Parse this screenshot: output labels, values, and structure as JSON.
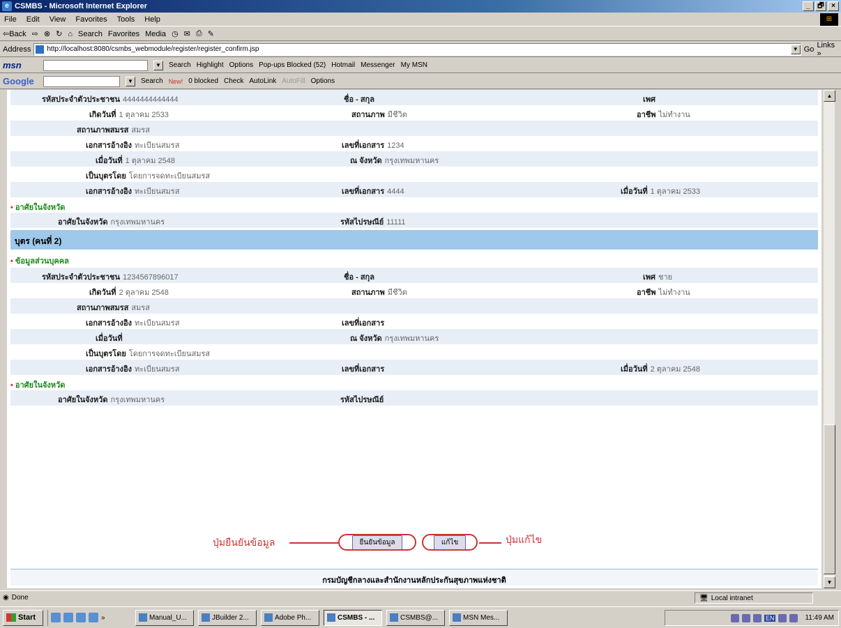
{
  "window": {
    "title": "CSMBS - Microsoft Internet Explorer",
    "min": "_",
    "max": "🗗",
    "close": "×"
  },
  "menu": [
    "File",
    "Edit",
    "View",
    "Favorites",
    "Tools",
    "Help"
  ],
  "toolbar": {
    "back": "⇦Back",
    "search": "Search",
    "favorites": "Favorites",
    "media": "Media"
  },
  "address": {
    "label": "Address",
    "url": "http://localhost:8080/csmbs_webmodule/register/register_confirm.jsp",
    "go": "Go",
    "links": "Links »"
  },
  "msn": {
    "logo": "msn",
    "search": "Search",
    "highlight": "Highlight",
    "options": "Options",
    "popups": "Pop-ups Blocked (52)",
    "hotmail": "Hotmail",
    "messenger": "Messenger",
    "mymsn": "My MSN"
  },
  "google": {
    "logo": "Google",
    "search": "Search",
    "new": "New!",
    "blocked": "0 blocked",
    "check": "Check",
    "autolink": "AutoLink",
    "autofill": "AutoFill",
    "options": "Options"
  },
  "person1": {
    "id_label": "รหัสประจำตัวประชาชน",
    "id_value": "4444444444444",
    "name_label": "ชื่อ - สกุล",
    "name_value": "",
    "sex_label": "เพศ",
    "sex_value": "",
    "dob_label": "เกิดวันที่",
    "dob_value": "1 ตุลาคม 2533",
    "status_label": "สถานภาพ",
    "status_value": "มีชีวิต",
    "job_label": "อาชีพ",
    "job_value": "ไม่ทำงาน",
    "marital_label": "สถานภาพสมรส",
    "marital_value": "สมรส",
    "ref1_label": "เอกสารอ้างอิง",
    "ref1_value": "ทะเบียนสมรส",
    "docno1_label": "เลขที่เอกสาร",
    "docno1_value": "1234",
    "when_label": "เมื่อวันที่",
    "when_value": "1 ตุลาคม 2548",
    "prov_label": "ณ จังหวัด",
    "prov_value": "กรุงเทพมหานคร",
    "child_label": "เป็นบุตรโดย",
    "child_value": "โดยการจดทะเบียนสมรส",
    "ref2_label": "เอกสารอ้างอิง",
    "ref2_value": "ทะเบียนสมรส",
    "docno2_label": "เลขที่เอกสาร",
    "docno2_value": "4444",
    "when2_label": "เมื่อวันที่",
    "when2_value": "1 ตุลาคม 2533",
    "resident_section": "อาศัยในจังหวัด",
    "resident_label": "อาศัยในจังหวัด",
    "resident_value": "กรุงเทพมหานคร",
    "postal_label": "รหัสไปรษณีย์",
    "postal_value": "11111"
  },
  "person2": {
    "header": "บุตร (คนที่ 2)",
    "personal_section": "ข้อมูลส่วนบุคคล",
    "id_label": "รหัสประจำตัวประชาชน",
    "id_value": "1234567896017",
    "name_label": "ชื่อ - สกุล",
    "name_value": "",
    "sex_label": "เพศ",
    "sex_value": "ชาย",
    "dob_label": "เกิดวันที่",
    "dob_value": "2 ตุลาคม 2548",
    "status_label": "สถานภาพ",
    "status_value": "มีชีวิต",
    "job_label": "อาชีพ",
    "job_value": "ไม่ทำงาน",
    "marital_label": "สถานภาพสมรส",
    "marital_value": "สมรส",
    "ref1_label": "เอกสารอ้างอิง",
    "ref1_value": "ทะเบียนสมรส",
    "docno1_label": "เลขที่เอกสาร",
    "docno1_value": "",
    "when_label": "เมื่อวันที่",
    "when_value": "",
    "prov_label": "ณ จังหวัด",
    "prov_value": "กรุงเทพมหานคร",
    "child_label": "เป็นบุตรโดย",
    "child_value": "โดยการจดทะเบียนสมรส",
    "ref2_label": "เอกสารอ้างอิง",
    "ref2_value": "ทะเบียนสมรส",
    "docno2_label": "เลขที่เอกสาร",
    "docno2_value": "",
    "when2_label": "เมื่อวันที่",
    "when2_value": "2 ตุลาคม 2548",
    "resident_section": "อาศัยในจังหวัด",
    "resident_label": "อาศัยในจังหวัด",
    "resident_value": "กรุงเทพมหานคร",
    "postal_label": "รหัสไปรษณีย์",
    "postal_value": ""
  },
  "actions": {
    "confirm_button": "ยืนยันข้อมูล",
    "edit_button": "แก้ไข",
    "confirm_annotation": "ปุ่มยืนยันข้อมูล",
    "edit_annotation": "ปุ่มแก้ไข"
  },
  "footer": "กรมบัญชีกลางและสำนักงานหลักประกันสุขภาพแห่งชาติ",
  "status": {
    "text": "Done",
    "zone": "Local intranet"
  },
  "taskbar": {
    "start": "Start",
    "more": "»",
    "buttons": [
      "Manual_U...",
      "JBuilder 2...",
      "Adobe Ph...",
      "CSMBS - ...",
      "CSMBS@...",
      "MSN Mes..."
    ],
    "lang": "EN",
    "clock": "11:49 AM"
  }
}
